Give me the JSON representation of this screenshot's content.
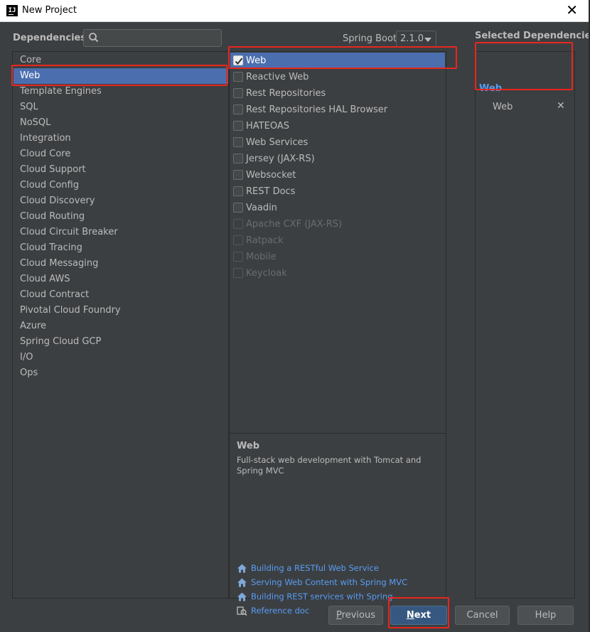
{
  "window": {
    "title": "New Project",
    "app_icon_text": "IJ",
    "close_glyph": "✕"
  },
  "header": {
    "dependencies_label": "Dependencies",
    "search": {
      "value": "",
      "placeholder": ""
    },
    "spring_boot_label": "Spring Boot",
    "spring_boot_version": "2.1.0",
    "selected_label": "Selected Dependencies"
  },
  "categories": [
    {
      "label": "Core",
      "selected": false
    },
    {
      "label": "Web",
      "selected": true
    },
    {
      "label": "Template Engines",
      "selected": false
    },
    {
      "label": "SQL",
      "selected": false
    },
    {
      "label": "NoSQL",
      "selected": false
    },
    {
      "label": "Integration",
      "selected": false
    },
    {
      "label": "Cloud Core",
      "selected": false
    },
    {
      "label": "Cloud Support",
      "selected": false
    },
    {
      "label": "Cloud Config",
      "selected": false
    },
    {
      "label": "Cloud Discovery",
      "selected": false
    },
    {
      "label": "Cloud Routing",
      "selected": false
    },
    {
      "label": "Cloud Circuit Breaker",
      "selected": false
    },
    {
      "label": "Cloud Tracing",
      "selected": false
    },
    {
      "label": "Cloud Messaging",
      "selected": false
    },
    {
      "label": "Cloud AWS",
      "selected": false
    },
    {
      "label": "Cloud Contract",
      "selected": false
    },
    {
      "label": "Pivotal Cloud Foundry",
      "selected": false
    },
    {
      "label": "Azure",
      "selected": false
    },
    {
      "label": "Spring Cloud GCP",
      "selected": false
    },
    {
      "label": "I/O",
      "selected": false
    },
    {
      "label": "Ops",
      "selected": false
    }
  ],
  "dependencies": [
    {
      "label": "Web",
      "checked": true,
      "enabled": true
    },
    {
      "label": "Reactive Web",
      "checked": false,
      "enabled": true
    },
    {
      "label": "Rest Repositories",
      "checked": false,
      "enabled": true
    },
    {
      "label": "Rest Repositories HAL Browser",
      "checked": false,
      "enabled": true
    },
    {
      "label": "HATEOAS",
      "checked": false,
      "enabled": true
    },
    {
      "label": "Web Services",
      "checked": false,
      "enabled": true
    },
    {
      "label": "Jersey (JAX-RS)",
      "checked": false,
      "enabled": true
    },
    {
      "label": "Websocket",
      "checked": false,
      "enabled": true
    },
    {
      "label": "REST Docs",
      "checked": false,
      "enabled": true
    },
    {
      "label": "Vaadin",
      "checked": false,
      "enabled": true
    },
    {
      "label": "Apache CXF (JAX-RS)",
      "checked": false,
      "enabled": false
    },
    {
      "label": "Ratpack",
      "checked": false,
      "enabled": false
    },
    {
      "label": "Mobile",
      "checked": false,
      "enabled": false
    },
    {
      "label": "Keycloak",
      "checked": false,
      "enabled": false
    }
  ],
  "description": {
    "title": "Web",
    "text": "Full-stack web development with Tomcat and Spring MVC",
    "links": [
      {
        "label": "Building a RESTful Web Service",
        "icon": "home-icon"
      },
      {
        "label": "Serving Web Content with Spring MVC",
        "icon": "home-icon"
      },
      {
        "label": "Building REST services with Spring",
        "icon": "home-icon"
      },
      {
        "label": "Reference doc",
        "icon": "reference-doc-icon"
      }
    ]
  },
  "selected": {
    "group": "Web",
    "items": [
      {
        "label": "Web",
        "remove_glyph": "✕"
      }
    ]
  },
  "buttons": {
    "previous": {
      "mnemonic": "P",
      "rest": "revious"
    },
    "next": {
      "mnemonic": "N",
      "rest": "ext"
    },
    "cancel": "Cancel",
    "help": "Help"
  },
  "colors": {
    "background": "#3c3f41",
    "selection": "#4b6eaf",
    "link": "#589df6",
    "annotation": "#e8261f",
    "primary_button": "#365880"
  }
}
